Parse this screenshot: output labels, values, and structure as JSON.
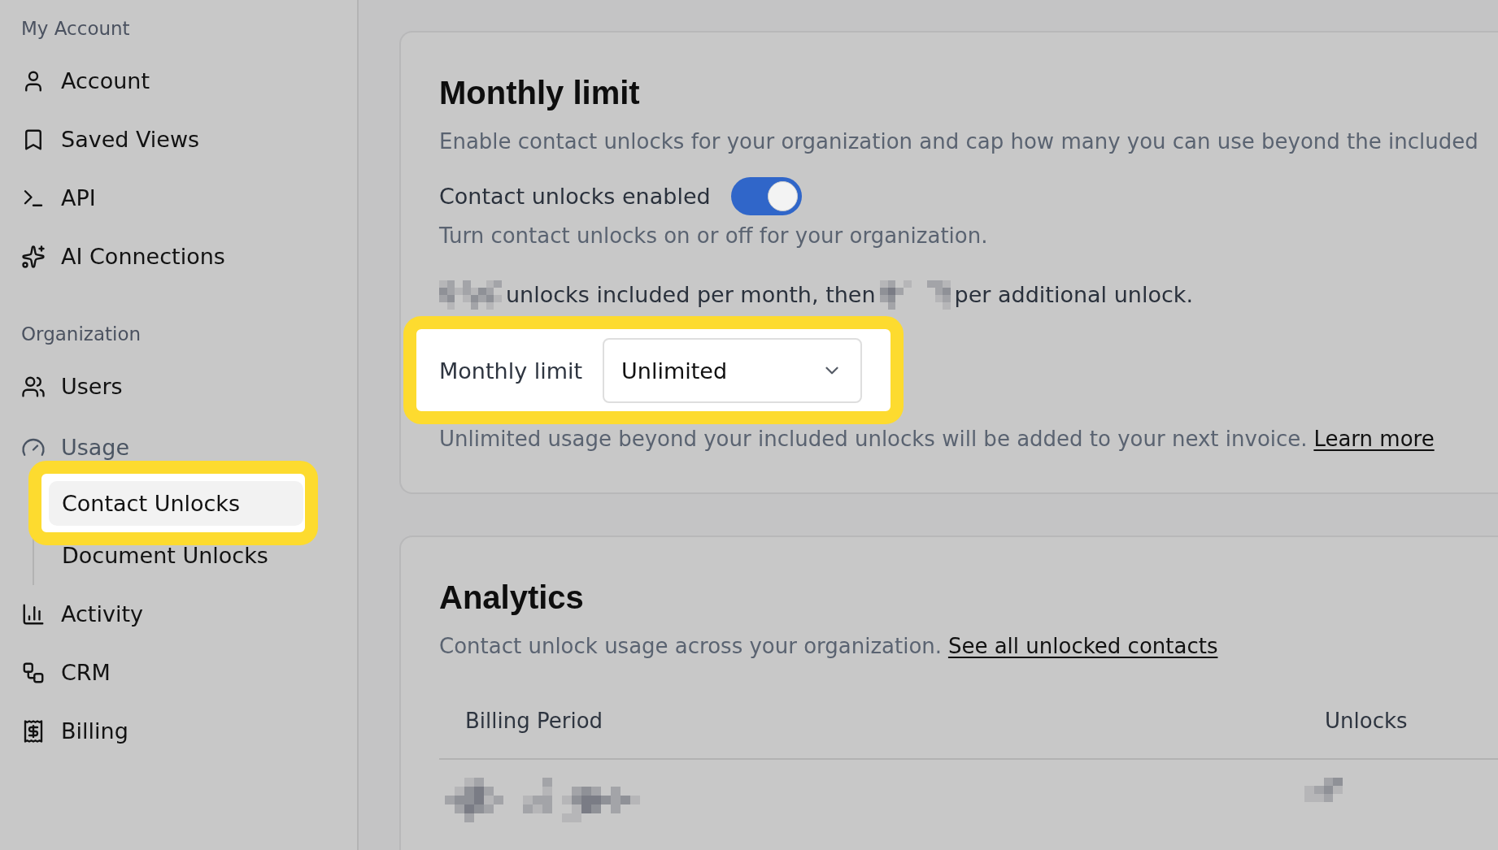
{
  "sidebar": {
    "sections": [
      {
        "heading": "My Account",
        "items": [
          {
            "label": "Account",
            "selected": false
          },
          {
            "label": "Saved Views",
            "selected": false
          },
          {
            "label": "API",
            "selected": false
          },
          {
            "label": "AI Connections",
            "selected": false
          }
        ]
      },
      {
        "heading": "Organization",
        "items": [
          {
            "label": "Users",
            "selected": false
          },
          {
            "label": "Usage",
            "selected": false,
            "expanded": true,
            "children": [
              {
                "label": "Contact Unlocks",
                "selected": true,
                "highlighted": true
              },
              {
                "label": "Document Unlocks",
                "selected": false,
                "highlighted": false
              }
            ]
          },
          {
            "label": "Activity",
            "selected": false
          },
          {
            "label": "CRM",
            "selected": false
          },
          {
            "label": "Billing",
            "selected": false
          }
        ]
      }
    ]
  },
  "monthly_limit": {
    "title": "Monthly limit",
    "description": "Enable contact unlocks for your organization and cap how many you can use beyond the included",
    "toggle": {
      "label": "Contact unlocks enabled",
      "on": true,
      "hint": "Turn contact unlocks on or off for your organization."
    },
    "allowance": [
      {
        "kind": "redacted"
      },
      {
        "kind": "text",
        "text": "unlocks included per month, then"
      },
      {
        "kind": "redacted"
      },
      {
        "kind": "text",
        "text": "per additional unlock."
      }
    ],
    "limit_field": {
      "label": "Monthly limit",
      "value": "Unlimited",
      "highlighted": true
    },
    "note": {
      "text": "Unlimited usage beyond your included unlocks will be added to your next invoice.",
      "link": "Learn more"
    }
  },
  "analytics": {
    "title": "Analytics",
    "description": "Contact unlock usage across your organization.",
    "link": "See all unlocked contacts",
    "table": {
      "columns": [
        "Billing Period",
        "Unlocks"
      ],
      "rows": [
        {
          "cells": [
            {
              "kind": "redacted"
            },
            {
              "kind": "redacted"
            }
          ]
        }
      ]
    }
  }
}
